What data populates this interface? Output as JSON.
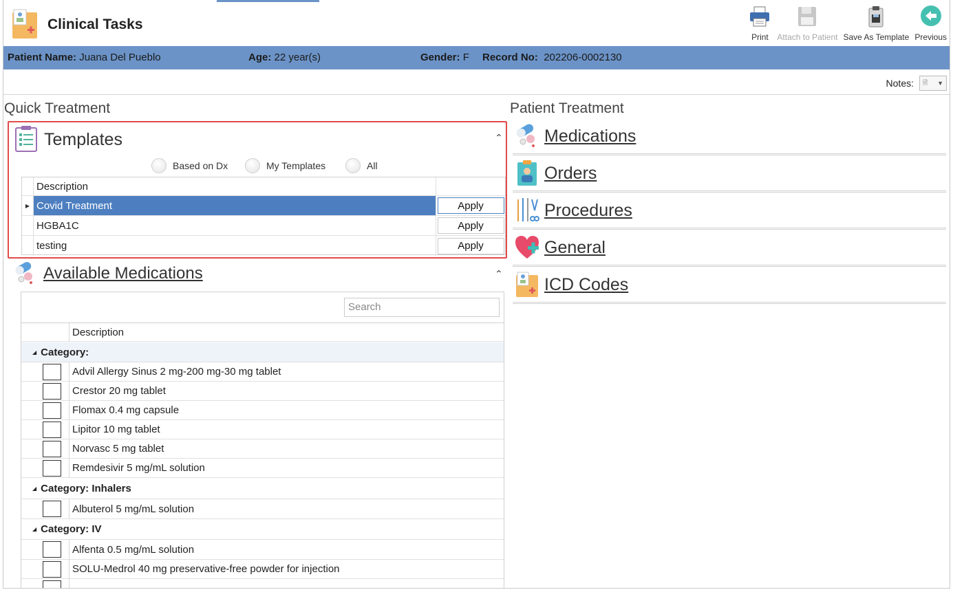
{
  "app": {
    "title": "Clinical Tasks"
  },
  "toolbar": {
    "print_label": "Print",
    "attach_label": "Attach to Patient",
    "save_template_label": "Save As Template",
    "previous_label": "Previous"
  },
  "patient": {
    "name_label": "Patient Name:",
    "name_value": "Juana Del Pueblo",
    "age_label": "Age:",
    "age_value": "22 year(s)",
    "gender_label": "Gender:",
    "gender_value": "F",
    "record_label": "Record No:",
    "record_value": "202206-0002130"
  },
  "notes": {
    "label": "Notes:"
  },
  "quick_treatment": {
    "title": "Quick Treatment",
    "templates": {
      "title": "Templates",
      "filters": [
        "Based on Dx",
        "My Templates",
        "All"
      ],
      "column_header": "Description",
      "rows": [
        {
          "description": "Covid Treatment",
          "action": "Apply",
          "selected": true
        },
        {
          "description": "HGBA1C",
          "action": "Apply",
          "selected": false
        },
        {
          "description": "testing",
          "action": "Apply",
          "selected": false
        }
      ]
    },
    "available_medications": {
      "title": "Available Medications",
      "search_placeholder": "Search",
      "column_header": "Description",
      "groups": [
        {
          "category": "Category:",
          "items": [
            "Advil Allergy Sinus 2 mg-200 mg-30 mg tablet",
            "Crestor 20 mg tablet",
            "Flomax 0.4 mg capsule",
            "Lipitor 10 mg tablet",
            "Norvasc 5 mg tablet",
            "Remdesivir 5 mg/mL solution"
          ]
        },
        {
          "category": "Category: Inhalers",
          "items": [
            "Albuterol 5 mg/mL solution"
          ]
        },
        {
          "category": "Category: IV",
          "items": [
            "Alfenta 0.5 mg/mL solution",
            "SOLU-Medrol 40 mg preservative-free powder for injection"
          ]
        }
      ]
    }
  },
  "patient_treatment": {
    "title": "Patient Treatment",
    "items": [
      {
        "label": "Medications",
        "icon": "pills-icon"
      },
      {
        "label": "Orders",
        "icon": "clipboard-doctor-icon"
      },
      {
        "label": "Procedures",
        "icon": "surgical-tools-icon"
      },
      {
        "label": "General",
        "icon": "heart-plus-icon"
      },
      {
        "label": "ICD Codes",
        "icon": "medical-folder-icon"
      }
    ]
  },
  "colors": {
    "accent": "#6b93c7",
    "selected_row": "#4d7fc0",
    "highlight_border": "#e14b4b"
  }
}
